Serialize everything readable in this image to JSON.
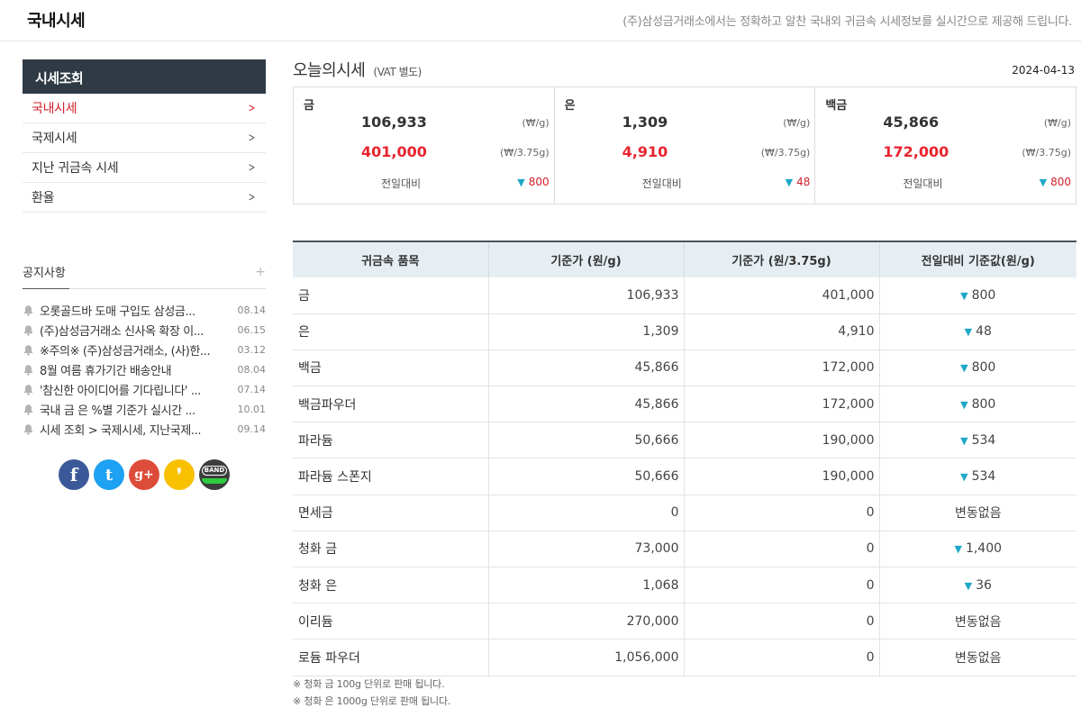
{
  "header": {
    "title": "국내시세",
    "description": "(주)삼성금거래소에서는 정확하고 알찬 국내외 귀금속 시세정보를 실시간으로 제공해 드립니다."
  },
  "sidebar": {
    "title": "시세조회",
    "items": [
      {
        "label": "국내시세"
      },
      {
        "label": "국제시세"
      },
      {
        "label": "지난 귀금속 시세"
      },
      {
        "label": "환율"
      }
    ]
  },
  "notice": {
    "title": "공지사항",
    "more": "+",
    "items": [
      {
        "text": "오롯골드바 도매 구입도 삼성금...",
        "date": "08.14"
      },
      {
        "text": "(주)삼성금거래소 신사옥 확장 이...",
        "date": "06.15"
      },
      {
        "text": "※주의※ (주)삼성금거래소, (사)한...",
        "date": "03.12"
      },
      {
        "text": "8월 여름 휴가기간 배송안내",
        "date": "08.04"
      },
      {
        "text": "'참신한 아이디어를 기다립니다' ...",
        "date": "07.14"
      },
      {
        "text": "국내 금 은 %별 기준가 실시간 ...",
        "date": "10.01"
      },
      {
        "text": "시세 조회 > 국제시세, 지난국제...",
        "date": "09.14"
      }
    ]
  },
  "social": [
    {
      "name": "facebook",
      "glyph": "f",
      "color": "#3b5998"
    },
    {
      "name": "twitter",
      "glyph": "t",
      "color": "#1da1f2"
    },
    {
      "name": "google-plus",
      "glyph": "g+",
      "color": "#dd4b39"
    },
    {
      "name": "kakaostory",
      "glyph": "❜",
      "color": "#f9c000"
    },
    {
      "name": "band",
      "glyph": "BAND",
      "color": "#3d3d3d"
    }
  ],
  "today": {
    "title": "오늘의시세",
    "vat": "(VAT 별도)",
    "date": "2024-04-13",
    "compare_label": "전일대비",
    "unit_g": "(₩/g)",
    "unit_don": "(₩/3.75g)",
    "cards": [
      {
        "name": "금",
        "price_g": "106,933",
        "price_don": "401,000",
        "change": "800"
      },
      {
        "name": "은",
        "price_g": "1,309",
        "price_don": "4,910",
        "change": "48"
      },
      {
        "name": "백금",
        "price_g": "45,866",
        "price_don": "172,000",
        "change": "800"
      }
    ]
  },
  "table": {
    "headers": [
      "귀금속 품목",
      "기준가 (원/g)",
      "기준가 (원/3.75g)",
      "전일대비 기준값(원/g)"
    ],
    "rows": [
      {
        "name": "금",
        "g": "106,933",
        "don": "401,000",
        "change": "800",
        "down": true
      },
      {
        "name": "은",
        "g": "1,309",
        "don": "4,910",
        "change": "48",
        "down": true
      },
      {
        "name": "백금",
        "g": "45,866",
        "don": "172,000",
        "change": "800",
        "down": true
      },
      {
        "name": "백금파우더",
        "g": "45,866",
        "don": "172,000",
        "change": "800",
        "down": true
      },
      {
        "name": "파라듐",
        "g": "50,666",
        "don": "190,000",
        "change": "534",
        "down": true
      },
      {
        "name": "파라듐 스폰지",
        "g": "50,666",
        "don": "190,000",
        "change": "534",
        "down": true
      },
      {
        "name": "면세금",
        "g": "0",
        "don": "0",
        "change": "변동없음",
        "down": false
      },
      {
        "name": "청화 금",
        "g": "73,000",
        "don": "0",
        "change": "1,400",
        "down": true
      },
      {
        "name": "청화 은",
        "g": "1,068",
        "don": "0",
        "change": "36",
        "down": true
      },
      {
        "name": "이리듐",
        "g": "270,000",
        "don": "0",
        "change": "변동없음",
        "down": false
      },
      {
        "name": "로듐 파우더",
        "g": "1,056,000",
        "don": "0",
        "change": "변동없음",
        "down": false
      }
    ]
  },
  "footnotes": [
    "※ 청화 금 100g 단위로 판매 됩니다.",
    "※ 청화 은 1000g 단위로 판매 됩니다."
  ],
  "colors": {
    "accent_red": "#e8242e",
    "down_arrow": "#1ea6c7",
    "sidebar_head": "#2f3a45",
    "table_head": "#e6eef3"
  }
}
